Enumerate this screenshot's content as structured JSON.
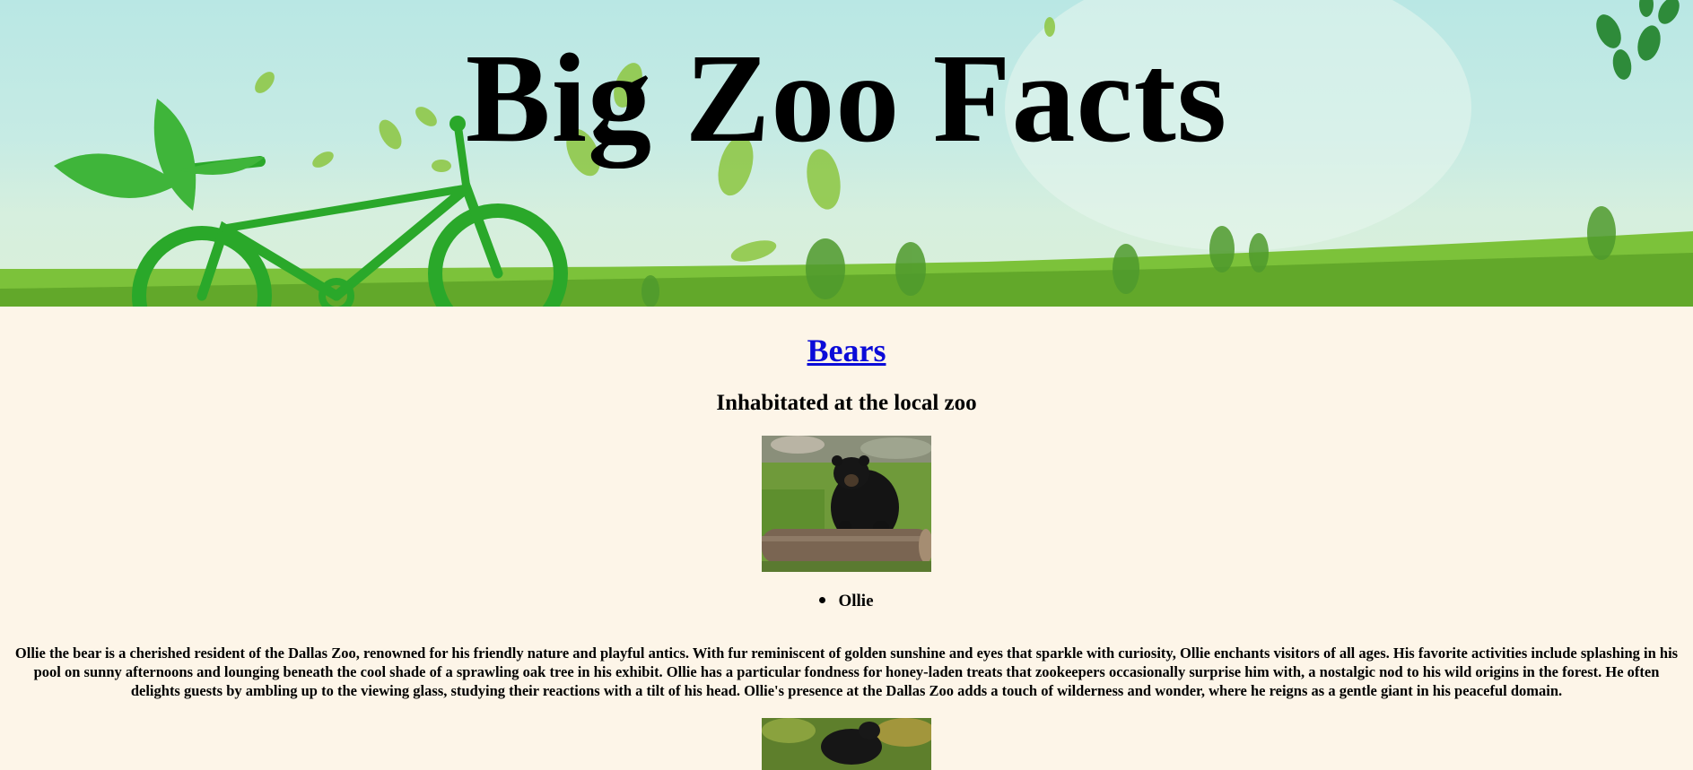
{
  "site": {
    "title": "Big Zoo Facts"
  },
  "section": {
    "animal_link": "Bears",
    "subtitle": "Inhabitated at the local zoo",
    "bear_names": [
      "Ollie"
    ],
    "description": "Ollie the bear is a cherished resident of the Dallas Zoo, renowned for his friendly nature and playful antics. With fur reminiscent of golden sunshine and eyes that sparkle with curiosity, Ollie enchants visitors of all ages. His favorite activities include splashing in his pool on sunny afternoons and lounging beneath the cool shade of a sprawling oak tree in his exhibit. Ollie has a particular fondness for honey-laden treats that zookeepers occasionally surprise him with, a nostalgic nod to his wild origins in the forest. He often delights guests by ambling up to the viewing glass, studying their reactions with a tilt of his head. Ollie's presence at the Dallas Zoo adds a touch of wilderness and wonder, where he reigns as a gentle giant in his peaceful domain."
  },
  "colors": {
    "page_background": "#fdf5e8",
    "link": "#0b0bd8",
    "banner_sky": "#b9e7e4",
    "banner_grass": "#6fb830"
  }
}
